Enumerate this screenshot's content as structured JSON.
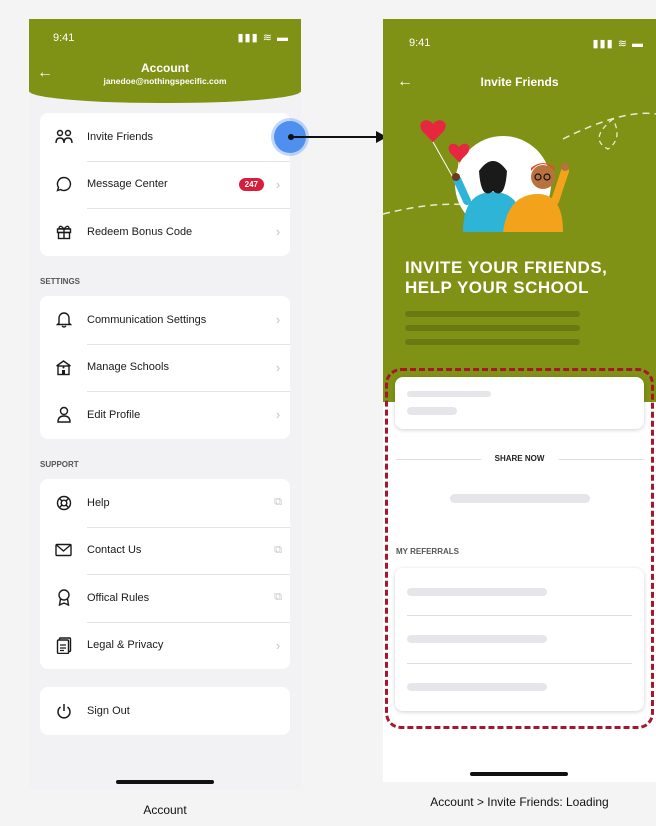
{
  "account": {
    "status_time": "9:41",
    "status_icons": "▮▮▮ ≋ ▬",
    "title": "Account",
    "email": "janedoe@nothingspecific.com",
    "group1": [
      {
        "label": "Invite Friends",
        "icon": "friends-icon"
      },
      {
        "label": "Message Center",
        "icon": "chat-bubble-icon",
        "badge": "247"
      },
      {
        "label": "Redeem Bonus Code",
        "icon": "gift-icon"
      }
    ],
    "settings_label": "SETTINGS",
    "settings": [
      {
        "label": "Communication Settings",
        "icon": "bell-icon"
      },
      {
        "label": "Manage Schools",
        "icon": "school-icon"
      },
      {
        "label": "Edit Profile",
        "icon": "person-icon"
      }
    ],
    "support_label": "SUPPORT",
    "support": [
      {
        "label": "Help",
        "icon": "lifebuoy-icon",
        "trailing": "external"
      },
      {
        "label": "Contact Us",
        "icon": "mail-icon",
        "trailing": "external"
      },
      {
        "label": "Offical Rules",
        "icon": "ribbon-icon",
        "trailing": "external"
      },
      {
        "label": "Legal & Privacy",
        "icon": "document-icon",
        "trailing": "chevron"
      }
    ],
    "sign_out": "Sign Out"
  },
  "invite": {
    "status_time": "9:41",
    "status_icons": "▮▮▮ ≋ ▬",
    "title": "Invite Friends",
    "headline_line1": "INVITE YOUR FRIENDS,",
    "headline_line2": "HELP YOUR SCHOOL",
    "share_now": "SHARE NOW",
    "my_referrals": "MY REFERRALS"
  },
  "captions": {
    "left": "Account",
    "right": "Account > Invite Friends: Loading"
  },
  "colors": {
    "brand_green": "#7f9216",
    "badge_red": "#d61f3d",
    "highlight_dash": "#a5182c",
    "pointer_blue": "#4f8ff0"
  }
}
